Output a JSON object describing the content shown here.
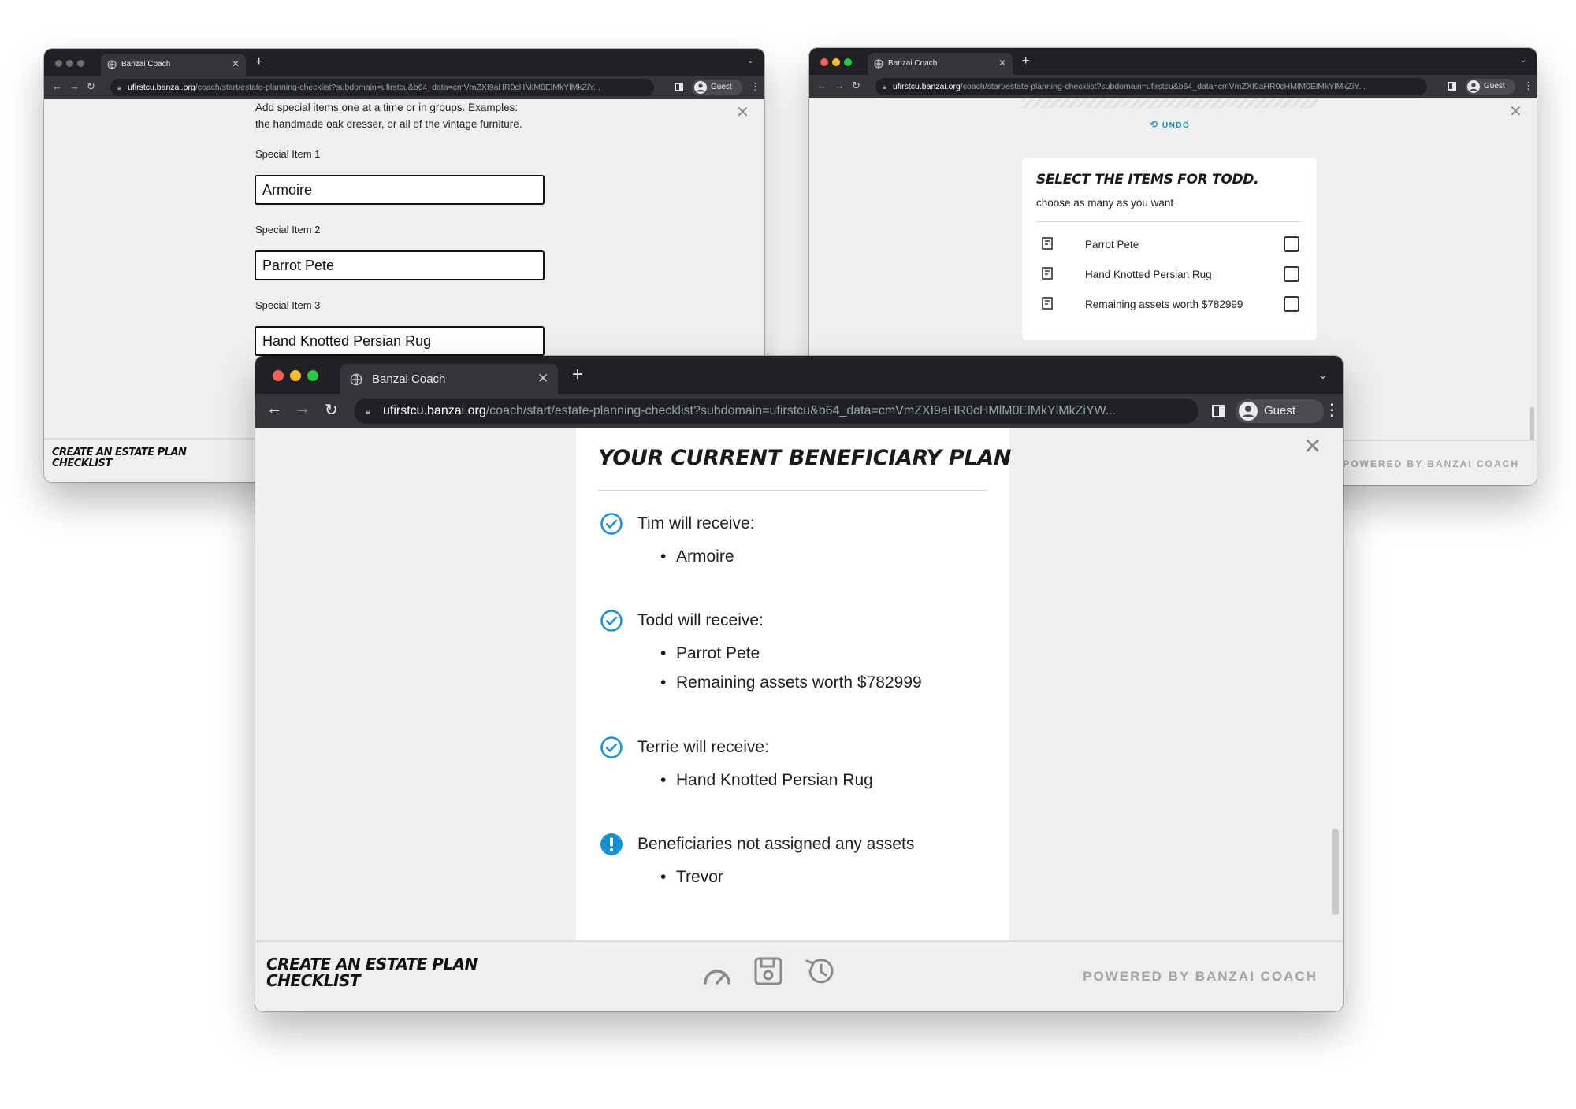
{
  "browser": {
    "tab_title": "Banzai Coach",
    "url_host": "ufirstcu.banzai.org",
    "url_path": "/coach/start/estate-planning-checklist?subdomain=ufirstcu&b64_data=cmVmZXI9aHR0cHMlM0ElMkYlMkZiYW...",
    "url_path_short": "/coach/start/estate-planning-checklist?subdomain=ufirstcu&b64_data=cmVmZXI9aHR0cHMlM0ElMkYlMkZiY...",
    "profile_label": "Guest"
  },
  "app": {
    "brand_line1": "Create an estate plan",
    "brand_line2": "checklist",
    "powered_by": "POWERED BY BANZAI COACH"
  },
  "window_left": {
    "instructions_line1": "Add special items one at a time or in groups. Examples:",
    "instructions_line2": "the handmade oak dresser, or all of the vintage furniture.",
    "fields": [
      {
        "label": "Special Item 1",
        "value": "Armoire"
      },
      {
        "label": "Special Item 2",
        "value": "Parrot Pete"
      },
      {
        "label": "Special Item 3",
        "value": "Hand Knotted Persian Rug"
      }
    ]
  },
  "window_right": {
    "undo_label": "UNDO",
    "heading": "Select the items for Todd.",
    "subheading": "choose as many as you want",
    "items": [
      {
        "label": "Parrot Pete",
        "checked": false
      },
      {
        "label": "Hand Knotted Persian Rug",
        "checked": false
      },
      {
        "label": "Remaining assets worth $782999",
        "checked": false
      }
    ]
  },
  "window_main": {
    "heading": "Your current beneficiary plan",
    "beneficiaries": [
      {
        "title": "Tim will receive:",
        "items": [
          "Armoire"
        ]
      },
      {
        "title": "Todd will receive:",
        "items": [
          "Parrot Pete",
          "Remaining assets worth $782999"
        ]
      },
      {
        "title": "Terrie will receive:",
        "items": [
          "Hand Knotted Persian Rug"
        ]
      }
    ],
    "unassigned": {
      "title": "Beneficiaries not assigned any assets",
      "items": [
        "Trevor"
      ]
    }
  },
  "icons": {
    "check": "check-circle-icon",
    "alert": "exclamation-circle-icon",
    "gauge": "gauge-icon",
    "save": "save-icon",
    "history": "history-icon",
    "item": "item-card-icon"
  },
  "colors": {
    "accent_blue": "#1a8fd1",
    "chrome_dark": "#202124",
    "chrome_toolbar": "#35363a",
    "content_bg": "#efefef",
    "muted_text": "#a3a3a3"
  }
}
